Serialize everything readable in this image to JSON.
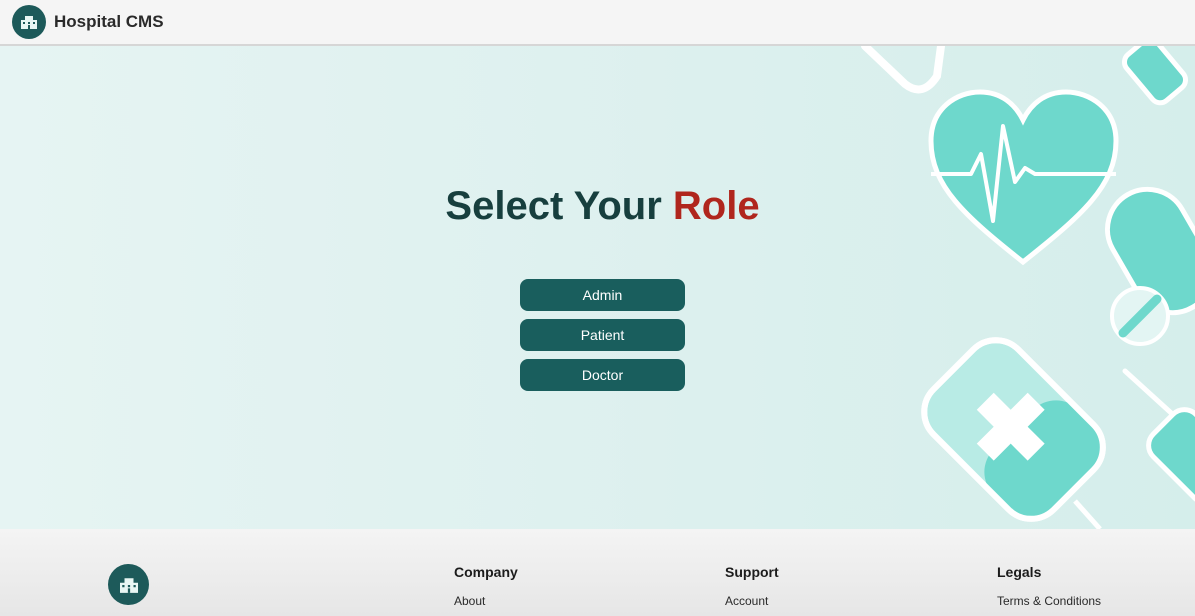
{
  "header": {
    "brand": "Hospital CMS",
    "logo_icon": "hospital-building-icon"
  },
  "main": {
    "title_part1": "Select Your ",
    "title_part2": "Role",
    "roles": [
      "Admin",
      "Patient",
      "Doctor"
    ]
  },
  "footer": {
    "logo_icon": "hospital-building-icon",
    "columns": [
      {
        "heading": "Company",
        "link": "About"
      },
      {
        "heading": "Support",
        "link": "Account"
      },
      {
        "heading": "Legals",
        "link": "Terms & Conditions"
      }
    ]
  },
  "decor_icons": [
    "heartbeat-heart-icon",
    "syringe-icon",
    "pill-icon",
    "stethoscope-icon"
  ],
  "colors": {
    "primary": "#195e5d",
    "title": "#173f3e",
    "accent": "#b0261d",
    "decor_teal": "#6ed8cc",
    "background": "#e3f3f1"
  }
}
